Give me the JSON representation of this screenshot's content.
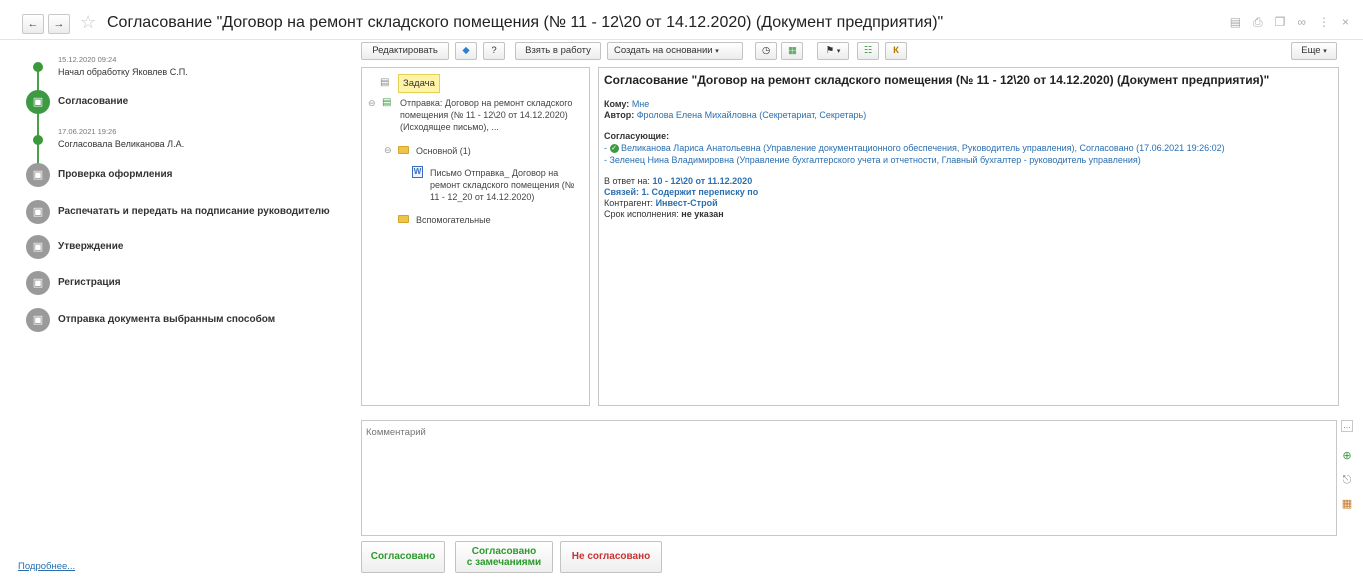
{
  "window": {
    "title": "Согласование \"Договор на ремонт складского помещения (№ 11 - 12\\20 от 14.12.2020) (Документ предприятия)\"",
    "back_icon": "arrow-left-icon",
    "forward_icon": "arrow-right-icon",
    "win_icons": [
      "save-icon",
      "print-icon",
      "copy-icon",
      "link-icon",
      "more-vertical-icon",
      "close-icon"
    ]
  },
  "route": {
    "steps": [
      {
        "kind": "done",
        "date": "15.12.2020 09:24",
        "who": "Начал обработку Яковлев С.П."
      },
      {
        "kind": "active",
        "label": "Согласование"
      },
      {
        "kind": "done",
        "date": "17.06.2021 19:26",
        "who": "Согласовала Великанова Л.А."
      },
      {
        "kind": "pending",
        "label": "Проверка оформления"
      },
      {
        "kind": "pending",
        "label": "Распечатать и передать на подписание руководителю"
      },
      {
        "kind": "pending",
        "label": "Утверждение"
      },
      {
        "kind": "pending",
        "label": "Регистрация"
      },
      {
        "kind": "pending",
        "label": "Отправка документа выбранным способом"
      }
    ],
    "more_link": "Подробнее..."
  },
  "toolbar": {
    "edit": "Редактировать",
    "take": "Взять в работу",
    "create_based": "Создать на основании",
    "more": "Еще"
  },
  "tree": {
    "task": "Задача",
    "item1": "Отправка: Договор на ремонт складского помещения (№ 11 - 12\\20 от 14.12.2020) (Исходящее письмо), ...",
    "group_main": "Основной (1)",
    "letter": "Письмо Отправка_ Договор на ремонт складского помещения (№ 11 - 12_20 от 14.12.2020)",
    "group_aux": "Вспомогательные"
  },
  "detail": {
    "title": "Согласование \"Договор на ремонт складского помещения (№ 11 - 12\\20 от 14.12.2020) (Документ предприятия)\"",
    "to_label": "Кому:",
    "to_value": "Мне",
    "author_label": "Автор:",
    "author_value": "Фролова Елена Михайловна (Секретариат, Секретарь)",
    "approvers_label": "Согласующие:",
    "approver1": "Великанова Лариса Анатольевна (Управление документационного обеспечения, Руководитель управления), Согласовано (17.06.2021 19:26:02)",
    "approver2": "- Зеленец Нина Владимировна (Управление бухгалтерского учета и отчетности, Главный бухгалтер - руководитель управления)",
    "reply_label": "В ответ на:",
    "reply_value": "10 - 12\\20 от 11.12.2020",
    "links_value": "Связей: 1. Содержит переписку по",
    "counterparty_label": "Контрагент:",
    "counterparty_value": "Инвест-Строй",
    "deadline_label": "Срок исполнения:",
    "deadline_value": "не указан"
  },
  "comment": {
    "placeholder": "Комментарий"
  },
  "actions": {
    "approved": "Согласовано",
    "approved_remarks_1": "Согласовано",
    "approved_remarks_2": "с замечаниями",
    "not_approved": "Не согласовано"
  },
  "colors": {
    "accent_green": "#3e9a42",
    "link_blue": "#2a6fb0",
    "reject_red": "#c83232"
  }
}
